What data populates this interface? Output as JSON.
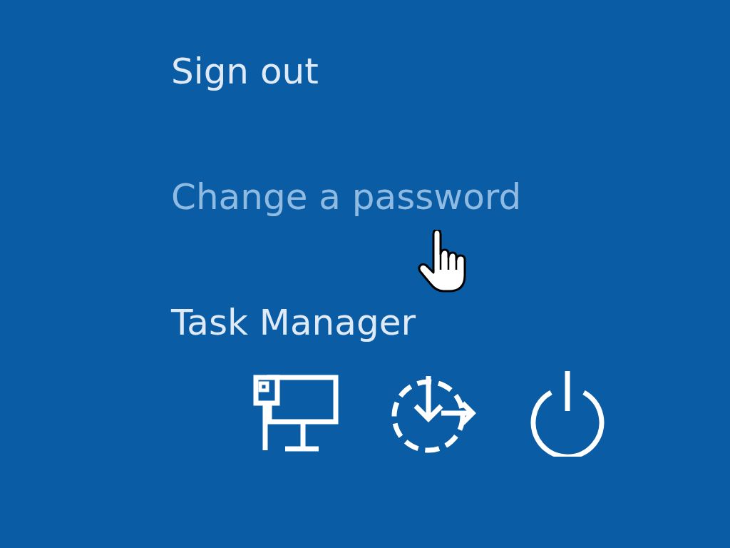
{
  "menu": [
    {
      "label": "Sign out",
      "hovered": false
    },
    {
      "label": "Change a password",
      "hovered": true
    },
    {
      "label": "Task Manager",
      "hovered": false
    }
  ],
  "icons": [
    {
      "kind": "network"
    },
    {
      "kind": "restart"
    },
    {
      "kind": "power"
    }
  ]
}
